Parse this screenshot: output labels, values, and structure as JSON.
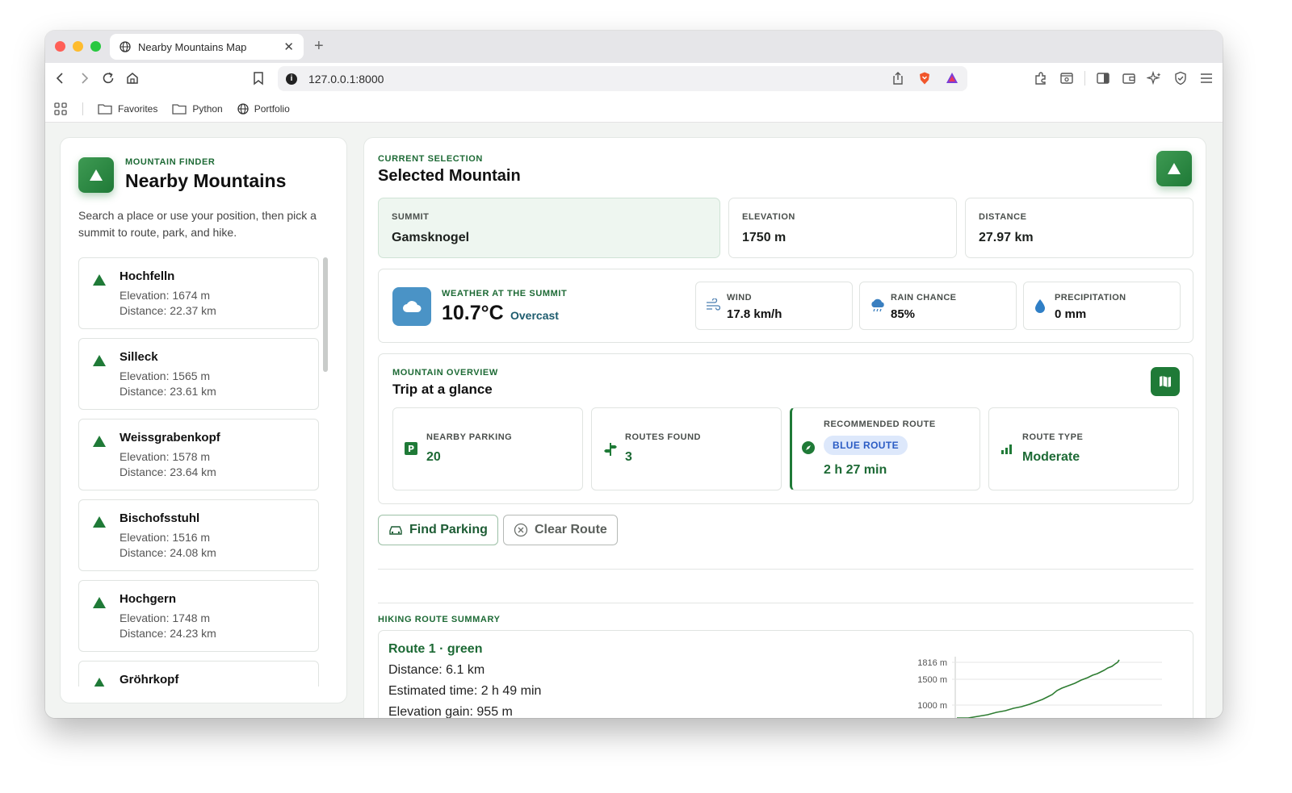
{
  "browser": {
    "tab_title": "Nearby Mountains Map",
    "url": "127.0.0.1:8000",
    "bookmarks": [
      "Favorites",
      "Python",
      "Portfolio"
    ]
  },
  "sidebar": {
    "eyebrow": "MOUNTAIN FINDER",
    "title": "Nearby Mountains",
    "description": "Search a place or use your position, then pick a summit to route, park, and hike.",
    "mountains": [
      {
        "name": "Hochfelln",
        "elevation": "Elevation: 1674 m",
        "distance": "Distance: 22.37 km"
      },
      {
        "name": "Silleck",
        "elevation": "Elevation: 1565 m",
        "distance": "Distance: 23.61 km"
      },
      {
        "name": "Weissgrabenkopf",
        "elevation": "Elevation: 1578 m",
        "distance": "Distance: 23.64 km"
      },
      {
        "name": "Bischofsstuhl",
        "elevation": "Elevation: 1516 m",
        "distance": "Distance: 24.08 km"
      },
      {
        "name": "Hochgern",
        "elevation": "Elevation: 1748 m",
        "distance": "Distance: 24.23 km"
      },
      {
        "name": "Gröhrkopf",
        "elevation": "",
        "distance": ""
      }
    ]
  },
  "selection": {
    "eyebrow": "CURRENT SELECTION",
    "title": "Selected Mountain",
    "summit_label": "SUMMIT",
    "summit": "Gamsknogel",
    "elevation_label": "ELEVATION",
    "elevation": "1750 m",
    "distance_label": "DISTANCE",
    "distance": "27.97 km"
  },
  "weather": {
    "eyebrow": "WEATHER AT THE SUMMIT",
    "temp": "10.7°C",
    "condition": "Overcast",
    "wind_label": "WIND",
    "wind": "17.8 km/h",
    "rain_label": "RAIN CHANCE",
    "rain": "85%",
    "precip_label": "PRECIPITATION",
    "precip": "0 mm"
  },
  "overview": {
    "eyebrow": "MOUNTAIN OVERVIEW",
    "title": "Trip at a glance",
    "parking_label": "NEARBY PARKING",
    "parking": "20",
    "routes_label": "ROUTES FOUND",
    "routes": "3",
    "recommended_label": "RECOMMENDED ROUTE",
    "recommended_badge": "BLUE ROUTE",
    "recommended_time": "2 h 27 min",
    "type_label": "ROUTE TYPE",
    "type": "Moderate"
  },
  "actions": {
    "find_parking": "Find Parking",
    "clear_route": "Clear Route"
  },
  "summary": {
    "eyebrow": "HIKING ROUTE SUMMARY",
    "route_name": "Route 1 · green",
    "distance": "Distance: 6.1 km",
    "time": "Estimated time: 2 h 49 min",
    "gain": "Elevation gain: 955 m"
  },
  "elevation_profile": {
    "tick_labels": [
      "1816 m",
      "1500 m",
      "1000 m"
    ],
    "line_color": "#2e7d32"
  },
  "colors": {
    "accent": "#1f7a37",
    "weather": "#4a93c6",
    "badge": "#dde8fb"
  }
}
